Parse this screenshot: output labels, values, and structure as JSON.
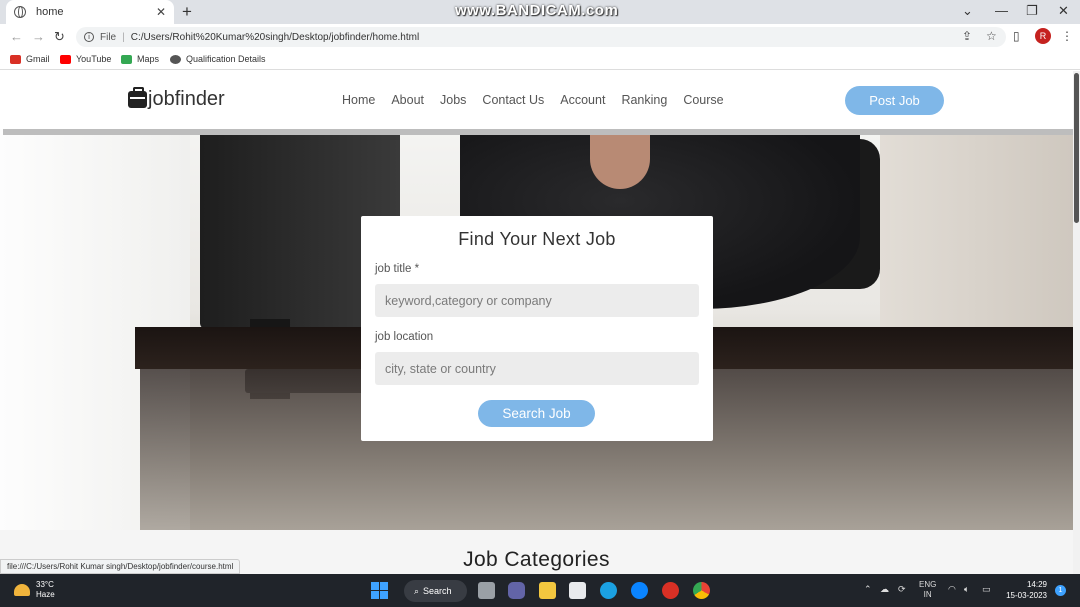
{
  "browser": {
    "tab_title": "home",
    "tab_close": "✕",
    "new_tab": "+",
    "watermark": "www.BANDICAM.com",
    "address_prefix": "File",
    "address_url": "C:/Users/Rohit%20Kumar%20singh/Desktop/jobfinder/home.html",
    "profile_initial": "R",
    "bookmarks": [
      {
        "label": "Gmail",
        "color": "#d93025"
      },
      {
        "label": "YouTube",
        "color": "#ff0000"
      },
      {
        "label": "Maps",
        "color": "#34a853"
      },
      {
        "label": "Qualification Details",
        "color": "#555555"
      }
    ],
    "status_url": "file:///C:/Users/Rohit Kumar singh/Desktop/jobfinder/course.html"
  },
  "site": {
    "logo_text": "jobfinder",
    "nav": [
      "Home",
      "About",
      "Jobs",
      "Contact Us",
      "Account",
      "Ranking",
      "Course"
    ],
    "post_job_label": "Post Job",
    "accent_color": "#7fb7e8"
  },
  "search": {
    "heading": "Find Your Next Job",
    "job_title_label": "job title *",
    "job_title_placeholder": "keyword,category or company",
    "location_label": "job location",
    "location_placeholder": "city, state or country",
    "button_label": "Search Job"
  },
  "categories": {
    "title": "Job Categories"
  },
  "taskbar": {
    "temperature": "33°C",
    "weather": "Haze",
    "search_label": "Search",
    "lang_1": "ENG",
    "lang_2": "IN",
    "time": "14:29",
    "date": "15-03-2023",
    "notification_count": "1"
  }
}
